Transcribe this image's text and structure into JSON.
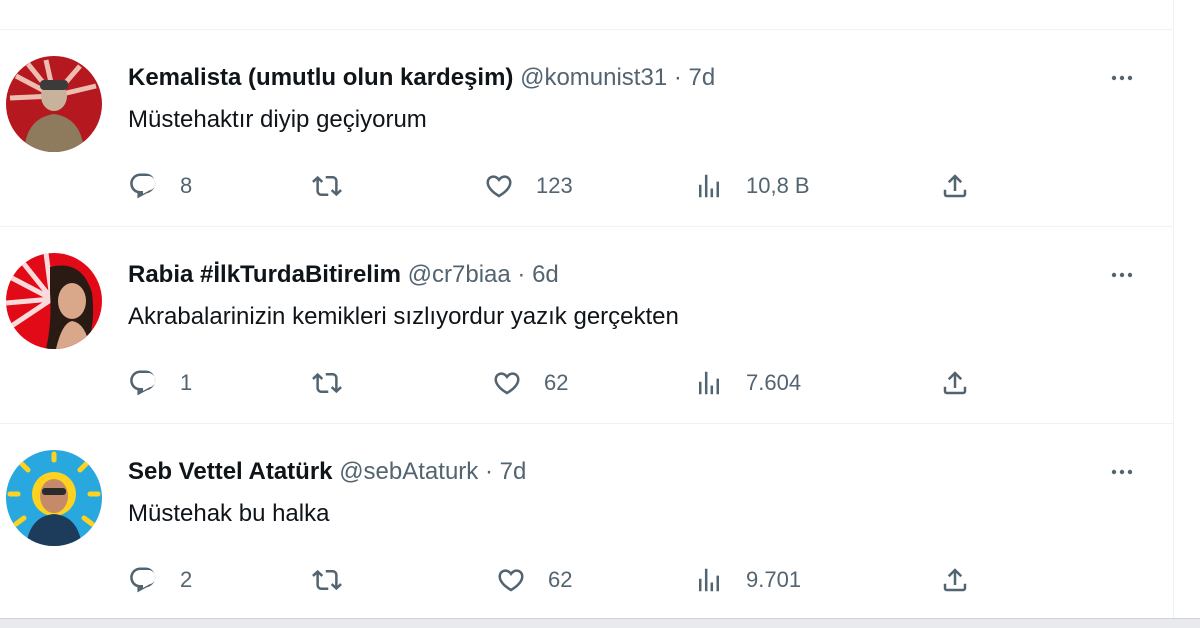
{
  "colors": {
    "text_primary": "#0f1419",
    "text_secondary": "#536471",
    "divider": "#eff3f4",
    "avatar1_bg": "#b5181f",
    "avatar2_bg": "#e30a17",
    "avatar3_bg": "#29a8e0"
  },
  "icons": [
    "more-icon",
    "reply-icon",
    "retweet-icon",
    "like-icon",
    "views-icon",
    "share-icon"
  ],
  "tweets": [
    {
      "name": "Kemalista (umutlu olun kardeşim)",
      "handle": "@komunist31",
      "sep": "·",
      "time": "7d",
      "text": "Müstehaktır diyip geçiyorum",
      "replies": "8",
      "retweets": "",
      "likes": "123",
      "views": "10,8 B"
    },
    {
      "name": "Rabia #İlkTurdaBitirelim",
      "handle": "@cr7biaa",
      "sep": "·",
      "time": "6d",
      "text": "Akrabalarinizin kemikleri sızlıyordur yazık gerçekten",
      "replies": "1",
      "retweets": "",
      "likes": "62",
      "views": "7.604"
    },
    {
      "name": "Seb Vettel Atatürk",
      "handle": "@sebAtaturk",
      "sep": "·",
      "time": "7d",
      "text": "Müstehak bu halka",
      "replies": "2",
      "retweets": "",
      "likes": "62",
      "views": "9.701"
    }
  ]
}
